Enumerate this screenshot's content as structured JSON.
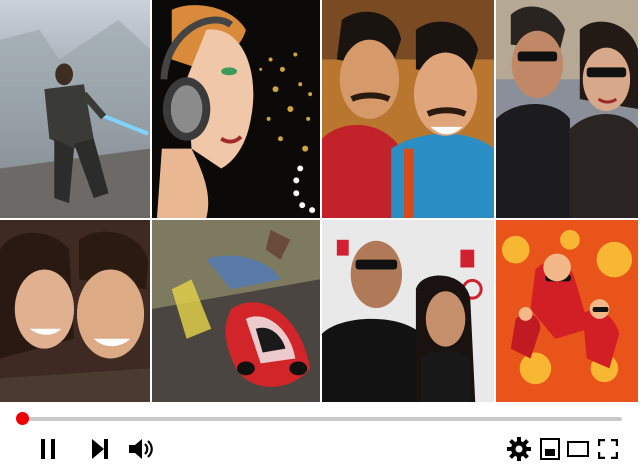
{
  "player": {
    "progress_fraction": 0.0,
    "accent_color": "#e00000",
    "thumbnails": [
      {
        "name": "thumbnail-game-soldier",
        "icon": "game-scene"
      },
      {
        "name": "thumbnail-woman-headphones",
        "icon": "portrait"
      },
      {
        "name": "thumbnail-two-comedians",
        "icon": "portrait"
      },
      {
        "name": "thumbnail-couple-sunglasses",
        "icon": "portrait"
      },
      {
        "name": "thumbnail-smiling-couple",
        "icon": "portrait"
      },
      {
        "name": "thumbnail-racing-car",
        "icon": "game-scene"
      },
      {
        "name": "thumbnail-red-carpet-couple",
        "icon": "portrait"
      },
      {
        "name": "thumbnail-animated-superheroes",
        "icon": "cartoon"
      }
    ],
    "buttons": {
      "left": [
        "pause-icon",
        "next-icon",
        "volume-icon"
      ],
      "right": [
        "settings-icon",
        "miniplayer-icon",
        "theater-mode-icon",
        "fullscreen-icon"
      ]
    }
  }
}
